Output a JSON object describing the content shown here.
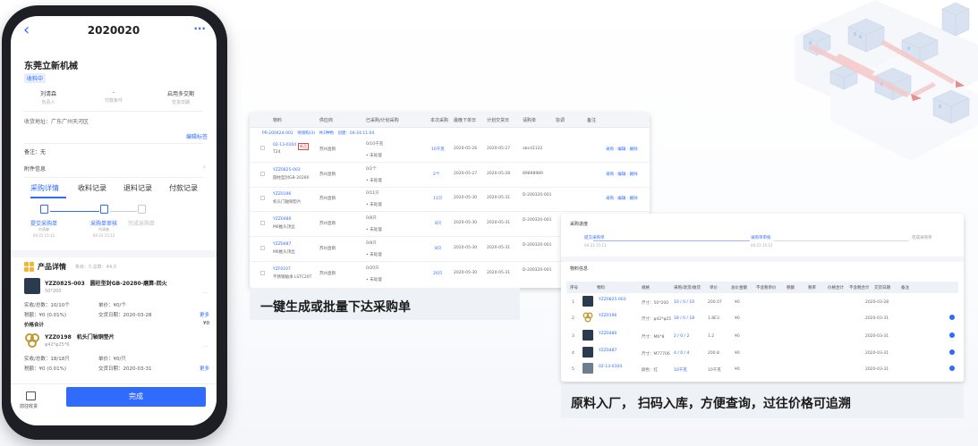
{
  "phone": {
    "back_icon": "chevron-left-icon",
    "more_icon": "ellipsis-icon",
    "title": "2020020",
    "company": "东莞立新机械",
    "status_badge": "收料中",
    "info": [
      {
        "value": "刘清森",
        "label": "负责人"
      },
      {
        "value": "-",
        "label": "付款条件"
      },
      {
        "value": "启用多交期",
        "label": "交货日期"
      }
    ],
    "address": "收货地址：广东广州天河区",
    "edit_tag": "编辑标签",
    "note": "备注：无",
    "attachment": "附件信息",
    "tabs": [
      "采购详情",
      "收料记录",
      "退料记录",
      "付款记录"
    ],
    "steps": [
      {
        "label": "提交采购单",
        "who": "刘清森",
        "time": "04-23 15:11"
      },
      {
        "label": "采购单审核",
        "who": "刘清森",
        "time": "04-23 15:12"
      },
      {
        "label": "完成采购单"
      }
    ],
    "product_section": {
      "title": "产品详情",
      "summary": "条目：5  总数：44.0"
    },
    "items": [
      {
        "name": "YZZ0825-003　圆柱型封GB-20280-磨算-回火",
        "spec": "50*200",
        "qty": "实收/总数：10/10个",
        "unit_price": "单价：¥0/个",
        "tax": "税额：¥0 (0.01%)",
        "delivery": "交货日期：2020-03-28",
        "more": "更多"
      },
      {
        "name": "YZZ0198　机头门轴铜垫片",
        "spec": "φ42*φ25*6",
        "qty": "实收/总数：18/18只",
        "unit_price": "单价：¥0/只",
        "tax": "税额：¥0 (0.01%)",
        "delivery": "交货日期：2020-03-31",
        "more": "更多"
      }
    ],
    "subtotal_label": "价格合计",
    "subtotal_value": "¥0",
    "receive_label": "前往收货",
    "done_button": "完成"
  },
  "table1": {
    "headers": [
      "物料",
      "供应商",
      "已采购/计划采购",
      "本次采购",
      "最晚下单日",
      "计划交货日",
      "请购单",
      "协调",
      "备注"
    ],
    "po_line": "PR-200424-001　待请购(3)　共1种物　创建：04-24 11:04",
    "rows": [
      {
        "code": "02-13-0104",
        "tag": "新品",
        "name": "T24",
        "supplier": "苏州直销",
        "planned": "0/10千克",
        "status": "• 未处理",
        "qty": "10千克",
        "latest": "2020-05-26",
        "delivery": "2020-05-27",
        "request": "abcd1122",
        "actions": "采购 · 编辑 · 删除"
      },
      {
        "code": "YZZ0825-003",
        "tag": "",
        "name": "圆柱型封GB-20280",
        "supplier": "苏州直销",
        "planned": "0/2个",
        "status": "• 未处理",
        "qty": "2个",
        "latest": "2020-05-27",
        "delivery": "2020-05-28",
        "request": "89898989",
        "actions": "采购 · 编辑 · 删除"
      },
      {
        "code": "YZZ0196",
        "tag": "",
        "name": "机头门轴铜垫片",
        "supplier": "苏州直销",
        "planned": "0/11只",
        "status": "• 未处理",
        "qty": "11只",
        "latest": "2020-05-30",
        "delivery": "2020-05-31",
        "request": "D-200320-001",
        "actions": "采购 · 编辑 · 删除"
      },
      {
        "code": "YZZ0480",
        "tag": "",
        "name": "M6推头顶丝",
        "supplier": "苏州直销",
        "planned": "0/8只",
        "status": "• 未处理",
        "qty": "8只",
        "latest": "2020-05-30",
        "delivery": "2020-05-31",
        "request": "D-200320-001",
        "actions": ""
      },
      {
        "code": "YZZ0487",
        "tag": "",
        "name": "M6推头顶丝",
        "supplier": "苏州直销",
        "planned": "0/8只",
        "status": "• 未处理",
        "qty": "8只",
        "latest": "2020-05-30",
        "delivery": "2020-05-31",
        "request": "D-200320-001",
        "actions": ""
      },
      {
        "code": "YZF0107",
        "tag": "",
        "name": "不锈钢轴承 LSTC20T",
        "supplier": "苏州直销",
        "planned": "0/20只",
        "status": "• 未处理",
        "qty": "20只",
        "latest": "2020-05-30",
        "delivery": "2020-05-31",
        "request": "D-200320-001",
        "actions": ""
      }
    ]
  },
  "caption1": "一键生成或批量下达采购单",
  "table2": {
    "title": "采购进度",
    "steps": [
      {
        "label": "提交采购单",
        "time": "04-23 15:11"
      },
      {
        "label": "采购单审核",
        "time": "04-23 15:12"
      },
      {
        "label": "完成采购单",
        "time": ""
      }
    ],
    "section": "物料信息",
    "headers": [
      "序号",
      "物料",
      "规格",
      "采购/退货/收货",
      "单价",
      "总价金额",
      "不含税单价",
      "税额",
      "税率",
      "价格合计",
      "不含税合计",
      "交货日期",
      "备注"
    ],
    "rows": [
      {
        "no": "1",
        "name": "YZZ0825-003",
        "spec": "尺寸：50*200",
        "qty": "10 / 0 / 10",
        "price": "200.07",
        "total": "¥0",
        "date": "2020-03-28"
      },
      {
        "no": "2",
        "name": "YZZ0196",
        "spec": "尺寸：φ42*φ25",
        "qty": "18 / 0 / 18",
        "price": "1.8E3",
        "total": "¥0",
        "date": "2020-03-31"
      },
      {
        "no": "3",
        "name": "YZZ0480",
        "spec": "尺寸：M6*8",
        "qty": "2 / 0 / 2",
        "price": "1.2",
        "total": "¥0",
        "date": "2020-03-31"
      },
      {
        "no": "4",
        "name": "YZZ0487",
        "spec": "尺寸：M77706",
        "qty": "4 / 0 / 4",
        "price": "200.8",
        "total": "¥0",
        "date": "2020-03-31"
      },
      {
        "no": "5",
        "name": "02-13-0104",
        "spec": "颜色：红",
        "qty": "10千克",
        "price": "10千克",
        "total": "¥0",
        "date": "2020-03-31"
      }
    ]
  },
  "caption2": "原料入厂，  扫码入库，方便查询，过往价格可追溯"
}
